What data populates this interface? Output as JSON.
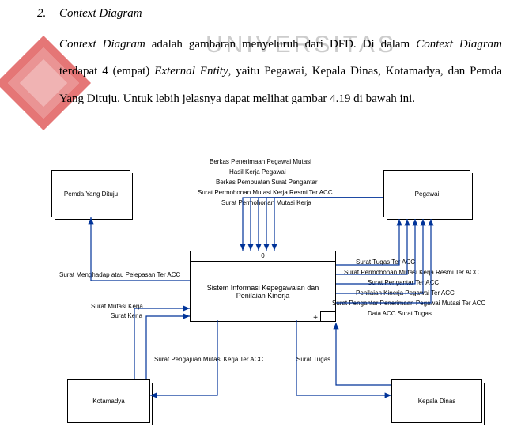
{
  "text": {
    "section_num": "2.",
    "section_title": "Context Diagram",
    "paragraph": "Context Diagram adalah gambaran menyeluruh dari DFD. Di dalam Context Diagram terdapat 4 (empat) External Entity, yaitu Pegawai, Kepala Dinas, Kotamadya, dan Pemda Yang Dituju. Untuk lebih jelasnya dapat melihat gambar 4.19 di bawah ini."
  },
  "watermark": "UNIVERSITAS",
  "diagram": {
    "entities": {
      "pemda": "Pemda Yang Dituju",
      "pegawai": "Pegawai",
      "kotamadya": "Kotamadya",
      "kepala": "Kepala Dinas"
    },
    "process": {
      "id": "0",
      "name": "Sistem Informasi Kepegawaian dan Penilaian Kinerja"
    },
    "flows": {
      "f1": "Berkas Penerimaan Pegawai Mutasi",
      "f2": "Hasil Kerja Pegawai",
      "f3": "Berkas Pembuatan Surat Pengantar",
      "f4": "Surat Permohonan Mutasi Kerja Resmi Ter ACC",
      "f5": "Surat Permohonan Mutasi Kerja",
      "f6": "Surat Menghadap atau Pelepasan Ter ACC",
      "f7": "Surat Mutasi Kerja",
      "f8": "Surat Kerja",
      "f9": "Surat Pengajuan Mutasi Kerja Ter ACC",
      "f10": "Surat Tugas",
      "f11": "Surat Tugas Ter ACC",
      "f12": "Surat Permohonan Mutasi Kerja Resmi Ter ACC",
      "f13": "Surat Pengantar Ter ACC",
      "f14": "Penilaian Kinerja Pegawai Ter ACC",
      "f15": "Surat Pengantar Penerimaan Pegawai Mutasi Ter ACC",
      "f16": "Data ACC Surat Tugas"
    }
  }
}
